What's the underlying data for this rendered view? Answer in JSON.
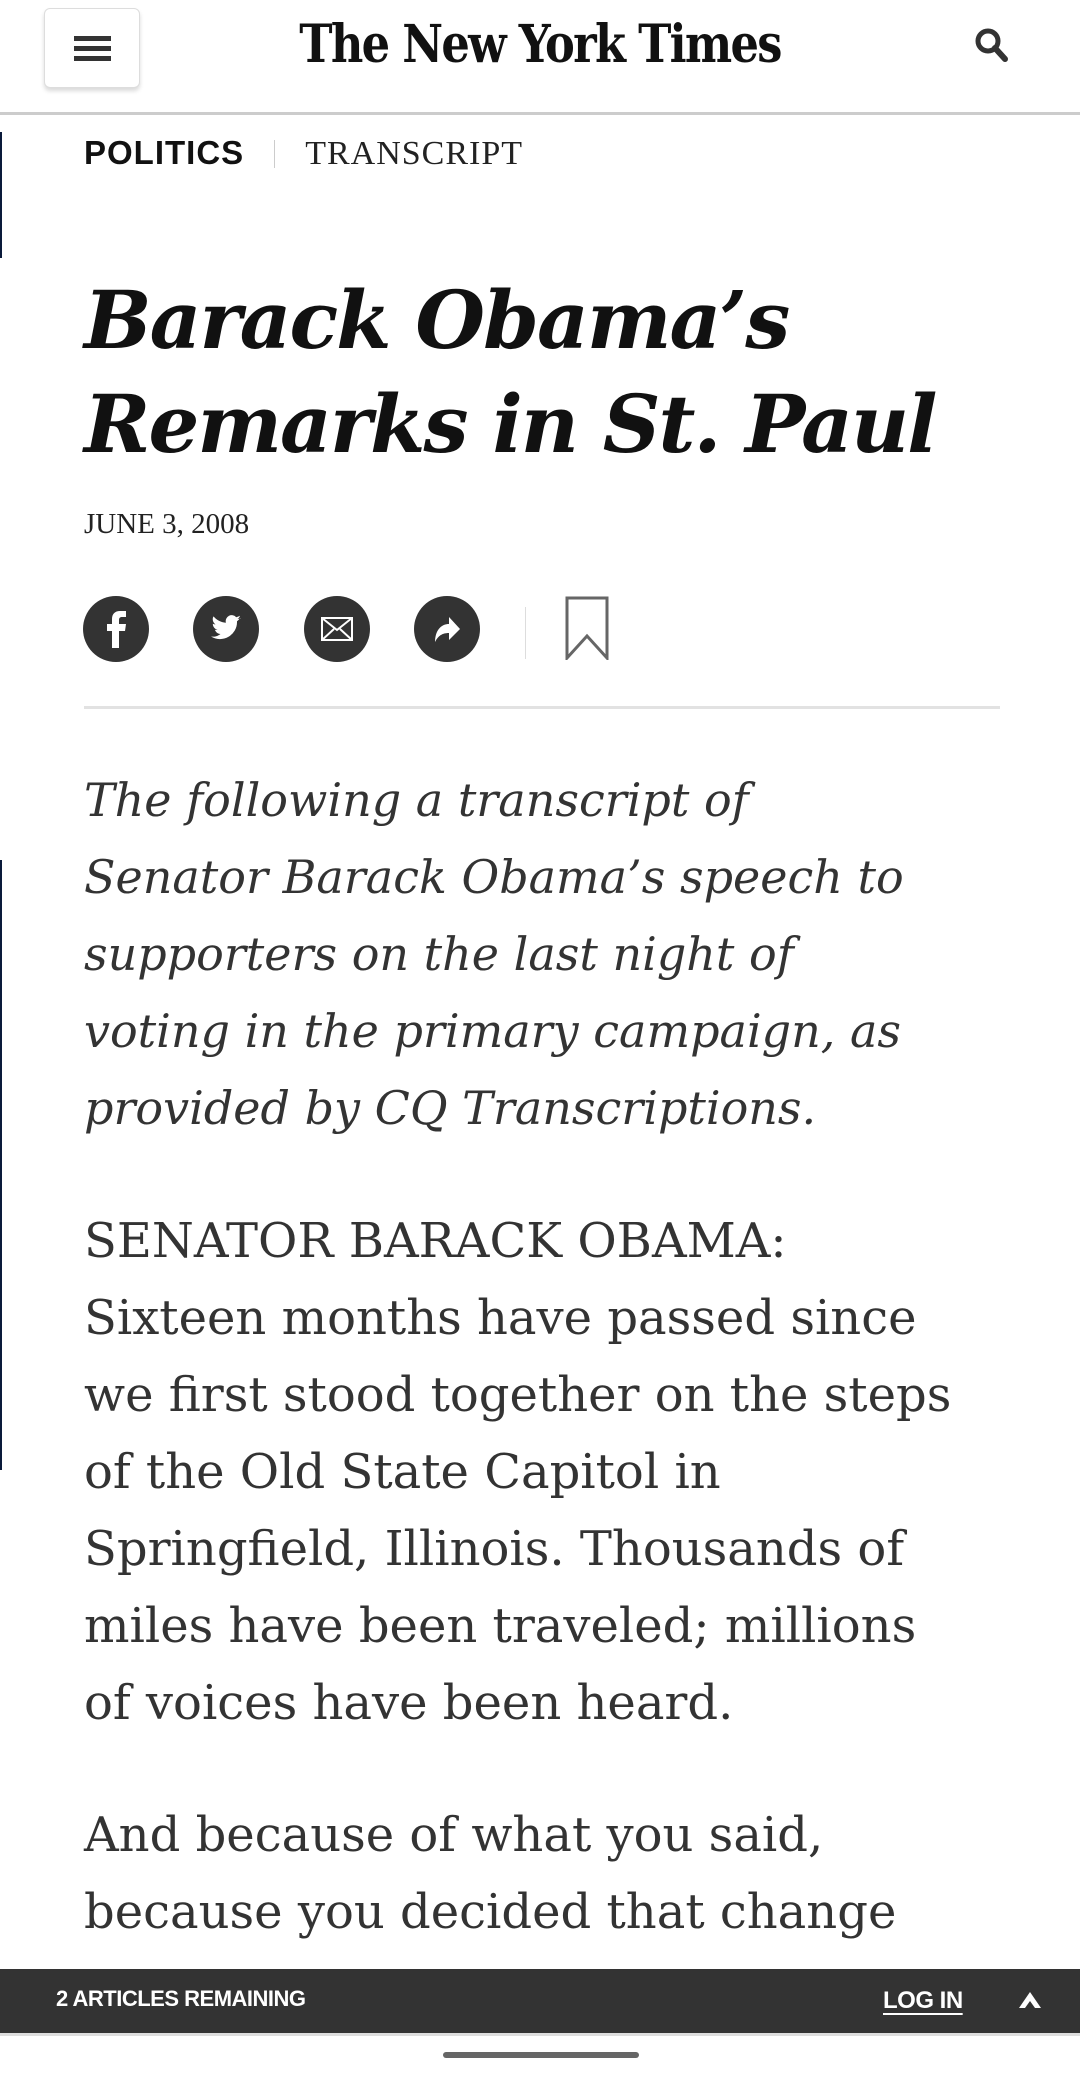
{
  "header": {
    "logo": "The New York Times",
    "menu_icon": "hamburger-icon",
    "search_icon": "search-icon"
  },
  "kicker": {
    "section": "POLITICS",
    "type": "TRANSCRIPT"
  },
  "article": {
    "title_lines": [
      "Barack Obama’s",
      "Remarks in St. Paul"
    ],
    "date": "JUNE 3, 2008",
    "share": [
      "facebook-icon",
      "twitter-icon",
      "email-icon",
      "share-icon",
      "bookmark-icon"
    ],
    "intro_lines": [
      "The following a transcript of",
      "Senator Barack Obama’s speech to",
      "supporters on the last night of",
      "voting in the primary campaign, as",
      "provided by CQ Transcriptions."
    ],
    "paragraph1_lines": [
      "SENATOR BARACK OBAMA:",
      "Sixteen months have passed since",
      "we first stood together on the steps",
      "of the Old State Capitol in",
      "Springfield, Illinois. Thousands of",
      "miles have been traveled; millions",
      "of voices have been heard."
    ],
    "paragraph2_lines": [
      "And because of what you said,",
      "because you decided that change"
    ]
  },
  "meter_bar": {
    "remaining": "2 ARTICLES REMAINING",
    "login": "LOG IN",
    "expand_icon": "chevron-up-icon"
  },
  "colors": {
    "bar": "#333333",
    "text": "#333333",
    "edge": "#0a1a3a"
  }
}
